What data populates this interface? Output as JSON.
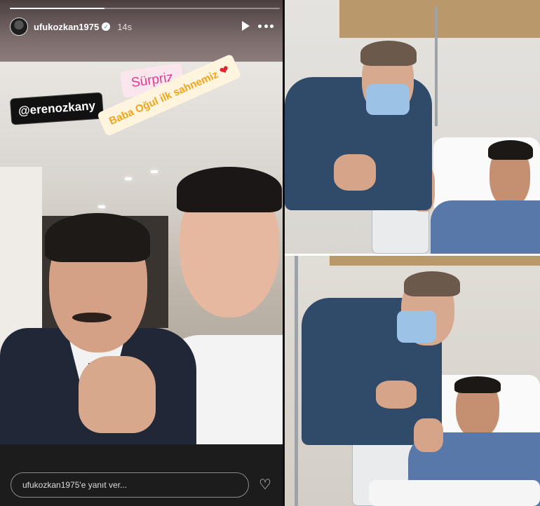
{
  "story": {
    "username": "ufukozkan1975",
    "timestamp": "14s",
    "progress": 0.35,
    "stickers": {
      "mention": "@erenozkany",
      "surprise": "Sürpriz",
      "caption": "Baba Oğul ilk sahnemiz",
      "caption_emoji": "❤"
    },
    "reply": {
      "placeholder": "ufukozkan1975'e yanıt ver..."
    }
  },
  "icons": {
    "verified": "verified-badge-icon",
    "play": "play-icon",
    "more": "more-options-icon",
    "like": "heart-outline-icon"
  },
  "colors": {
    "surprise_text": "#e03b8b",
    "caption_text": "#f0a51b",
    "mention_bg": "#111111"
  }
}
